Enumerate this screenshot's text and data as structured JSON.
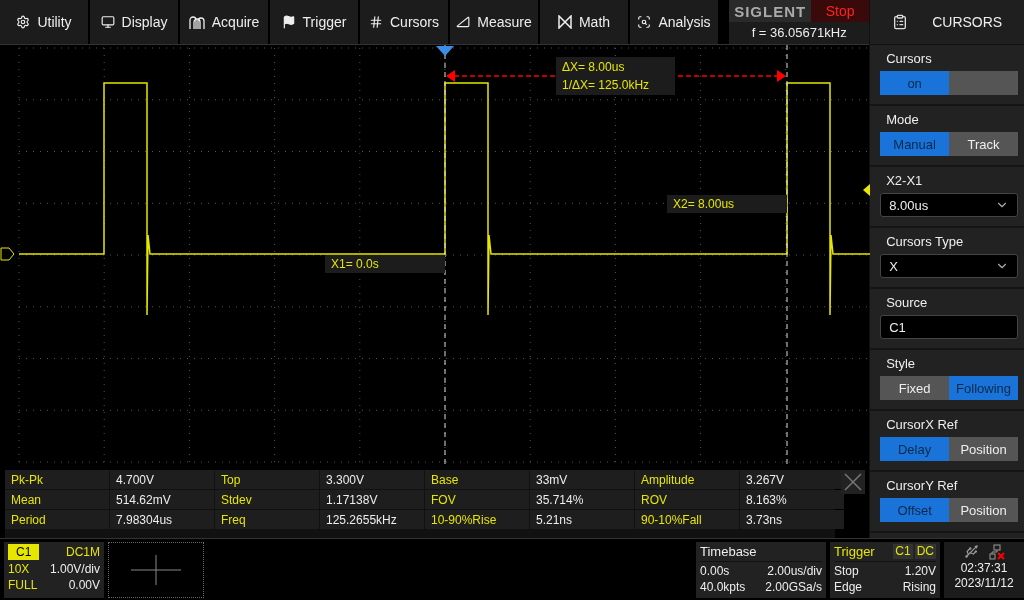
{
  "menu": [
    {
      "label": "Utility"
    },
    {
      "label": "Display"
    },
    {
      "label": "Acquire"
    },
    {
      "label": "Trigger"
    },
    {
      "label": "Cursors"
    },
    {
      "label": "Measure"
    },
    {
      "label": "Math"
    },
    {
      "label": "Analysis"
    }
  ],
  "brand": {
    "logo": "SIGLENT",
    "run_state": "Stop",
    "frequency": "f = 36.05671kHz"
  },
  "scope": {
    "delta": "ΔX= 8.00us",
    "inverse": "1/ΔX= 125.0kHz",
    "x1": "X1= 0.0s",
    "x2": "X2= 8.00us"
  },
  "measurements": [
    [
      {
        "name": "Pk-Pk",
        "value": "4.700V"
      },
      {
        "name": "Top",
        "value": "3.300V"
      },
      {
        "name": "Base",
        "value": "33mV"
      },
      {
        "name": "Amplitude",
        "value": "3.267V"
      }
    ],
    [
      {
        "name": "Mean",
        "value": "514.62mV"
      },
      {
        "name": "Stdev",
        "value": "1.17138V"
      },
      {
        "name": "FOV",
        "value": "35.714%"
      },
      {
        "name": "ROV",
        "value": "8.163%"
      }
    ],
    [
      {
        "name": "Period",
        "value": "7.98304us"
      },
      {
        "name": "Freq",
        "value": "125.2655kHz"
      },
      {
        "name": "10-90%Rise",
        "value": "5.21ns"
      },
      {
        "name": "90-10%Fall",
        "value": "3.73ns"
      }
    ]
  ],
  "panel": {
    "title": "CURSORS",
    "sections": [
      {
        "kind": "toggle",
        "label": "Cursors",
        "value": "on",
        "on": true
      },
      {
        "kind": "segmented",
        "label": "Mode",
        "options": [
          {
            "label": "Manual",
            "selected": true
          },
          {
            "label": "Track",
            "selected": false
          }
        ]
      },
      {
        "kind": "dropdown",
        "label": "X2-X1",
        "value": "8.00us"
      },
      {
        "kind": "dropdown",
        "label": "Cursors Type",
        "value": "X"
      },
      {
        "kind": "field",
        "label": "Source",
        "value": "C1"
      },
      {
        "kind": "segmented",
        "label": "Style",
        "options": [
          {
            "label": "Fixed",
            "selected": false
          },
          {
            "label": "Following",
            "selected": true
          }
        ]
      },
      {
        "kind": "segmented",
        "label": "CursorX Ref",
        "options": [
          {
            "label": "Delay",
            "selected": true
          },
          {
            "label": "Position",
            "selected": false
          }
        ]
      },
      {
        "kind": "segmented",
        "label": "CursorY Ref",
        "options": [
          {
            "label": "Offset",
            "selected": true
          },
          {
            "label": "Position",
            "selected": false
          }
        ]
      }
    ]
  },
  "channel": {
    "name": "C1",
    "coupling": "DC1M",
    "probe": "10X",
    "scale": "1.00V/div",
    "bandwidth": "FULL",
    "offset": "0.00V"
  },
  "timebase": {
    "title": "Timebase",
    "delay": "0.00s",
    "scale": "2.00us/div",
    "memory": "40.0kpts",
    "rate": "2.00GSa/s"
  },
  "trigger": {
    "title": "Trigger",
    "source": "C1",
    "coupling": "DC",
    "state": "Stop",
    "level": "1.20V",
    "type": "Edge",
    "slope": "Rising"
  },
  "status": {
    "time": "02:37:31",
    "date": "2023/11/12"
  }
}
